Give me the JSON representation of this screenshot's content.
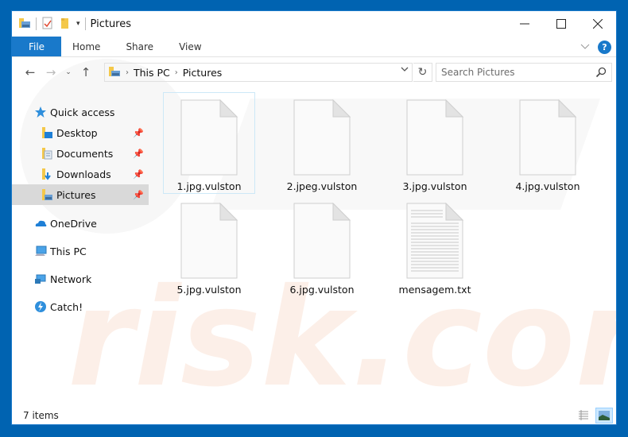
{
  "window": {
    "title": "Pictures",
    "controls": {
      "minimize": "minimize",
      "maximize": "maximize",
      "close": "close"
    }
  },
  "quick_access_toolbar": {
    "icons": [
      "folder-pictures-icon",
      "properties-icon",
      "new-folder-icon",
      "customize-dropdown-icon"
    ]
  },
  "ribbon": {
    "tabs": [
      {
        "label": "File",
        "active": true
      },
      {
        "label": "Home"
      },
      {
        "label": "Share"
      },
      {
        "label": "View"
      }
    ],
    "help_label": "?"
  },
  "address_bar": {
    "breadcrumbs": [
      "This PC",
      "Pictures"
    ],
    "search_placeholder": "Search Pictures"
  },
  "nav_pane": {
    "items": [
      {
        "label": "Quick access",
        "icon": "star-icon",
        "level": 0
      },
      {
        "label": "Desktop",
        "icon": "desktop-folder-icon",
        "level": 1,
        "pinned": true
      },
      {
        "label": "Documents",
        "icon": "documents-folder-icon",
        "level": 1,
        "pinned": true
      },
      {
        "label": "Downloads",
        "icon": "downloads-folder-icon",
        "level": 1,
        "pinned": true
      },
      {
        "label": "Pictures",
        "icon": "pictures-folder-icon",
        "level": 1,
        "pinned": true,
        "selected": true
      },
      {
        "label": "OneDrive",
        "icon": "cloud-icon",
        "level": 0
      },
      {
        "label": "This PC",
        "icon": "computer-icon",
        "level": 0
      },
      {
        "label": "Network",
        "icon": "network-icon",
        "level": 0
      },
      {
        "label": "Catch!",
        "icon": "catch-icon",
        "level": 0
      }
    ]
  },
  "files": [
    {
      "name": "1.jpg.vulston",
      "type": "blank",
      "focused": true
    },
    {
      "name": "2.jpeg.vulston",
      "type": "blank"
    },
    {
      "name": "3.jpg.vulston",
      "type": "blank"
    },
    {
      "name": "4.jpg.vulston",
      "type": "blank"
    },
    {
      "name": "5.jpg.vulston",
      "type": "blank"
    },
    {
      "name": "6.jpg.vulston",
      "type": "blank"
    },
    {
      "name": "mensagem.txt",
      "type": "text"
    }
  ],
  "status_bar": {
    "item_count": "7 items",
    "views": [
      {
        "name": "details-view",
        "active": false
      },
      {
        "name": "large-icons-view",
        "active": true
      }
    ]
  },
  "colors": {
    "accent": "#1979ca",
    "desktop_bg": "#0063b1",
    "selection": "#d9d9d9"
  }
}
